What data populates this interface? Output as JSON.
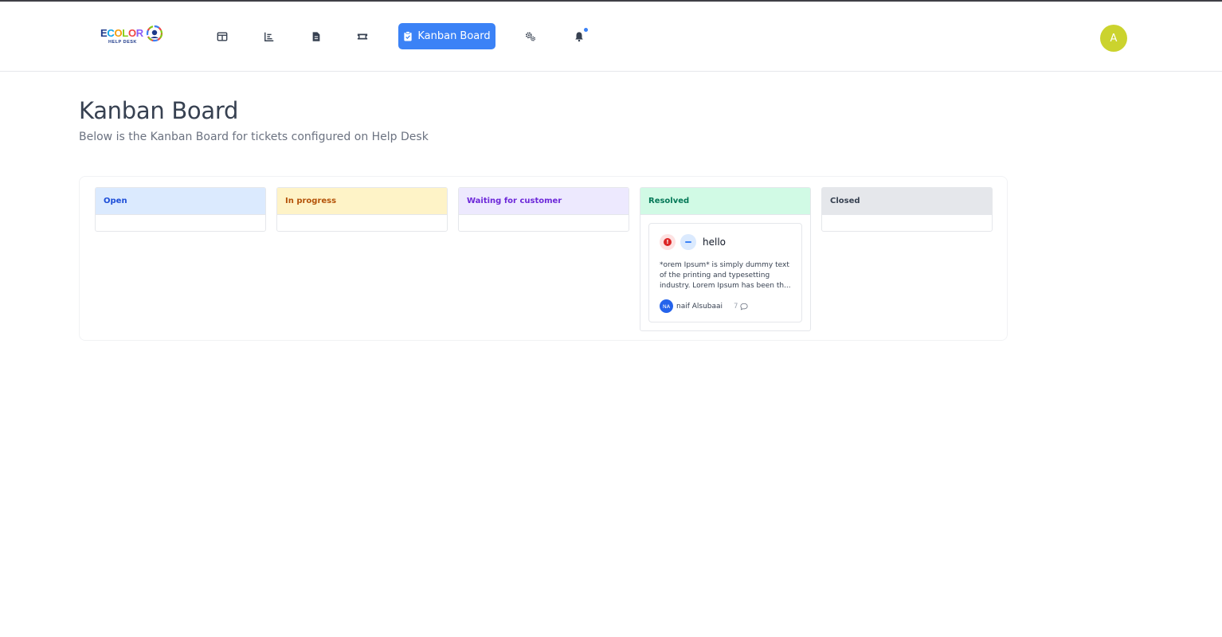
{
  "brand": {
    "logo_letters": [
      "E",
      "C",
      "O",
      "L",
      "O",
      "R"
    ],
    "logo_sub": "HELP DESK"
  },
  "nav": {
    "items": [
      {
        "icon": "table-layout-icon"
      },
      {
        "icon": "bar-chart-icon"
      },
      {
        "icon": "document-icon"
      },
      {
        "icon": "ticket-icon"
      },
      {
        "icon": "clipboard-check-icon",
        "label": "Kanban Board",
        "active": true
      },
      {
        "icon": "gears-icon"
      },
      {
        "icon": "bell-icon",
        "has_notification": true
      }
    ],
    "active_label": "Kanban Board",
    "accent_color": "#3b82f6"
  },
  "user": {
    "avatar_initial": "A",
    "avatar_color": "#cbd32e"
  },
  "page": {
    "title": "Kanban Board",
    "subtitle": "Below is the Kanban Board for tickets configured on Help Desk"
  },
  "columns": [
    {
      "name": "Open",
      "header_bg": "#dbeafe",
      "header_color": "#1d4ed8",
      "cards": []
    },
    {
      "name": "In progress",
      "header_bg": "#fef3c7",
      "header_color": "#b45309",
      "cards": []
    },
    {
      "name": "Waiting for customer",
      "header_bg": "#ede9fe",
      "header_color": "#6d28d9",
      "cards": []
    },
    {
      "name": "Resolved",
      "header_bg": "#d1fae5",
      "header_color": "#047857",
      "cards": [
        {
          "title": "hello",
          "priority_icon": "exclamation-circle-icon",
          "status_icon": "minus-circle-icon",
          "description": "*orem Ipsum* is simply dummy text of the printing and typesetting industry. Lorem Ipsum has been th...",
          "assignee_initials": "NA",
          "assignee_name": "naif Alsubaai",
          "comment_count": "7"
        }
      ]
    },
    {
      "name": "Closed",
      "header_bg": "#e5e7eb",
      "header_color": "#374151",
      "cards": []
    }
  ]
}
